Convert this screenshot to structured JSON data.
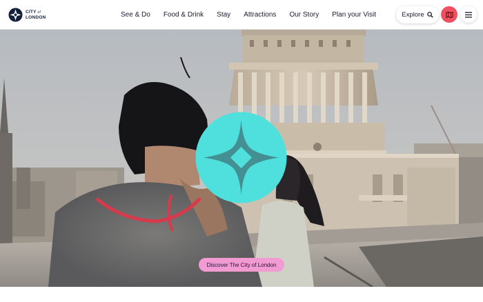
{
  "logo": {
    "line1": "CITY",
    "of": "of",
    "line2": "LONDON"
  },
  "nav": {
    "items": [
      {
        "label": "See & Do"
      },
      {
        "label": "Food & Drink"
      },
      {
        "label": "Stay"
      },
      {
        "label": "Attractions"
      },
      {
        "label": "Our Story"
      },
      {
        "label": "Plan your Visit"
      }
    ]
  },
  "header": {
    "explore_label": "Explore"
  },
  "hero": {
    "cta_label": "Discover The City of London"
  },
  "colors": {
    "accent_teal": "#4fe0dd",
    "map_button": "#f0505f",
    "cta_pink": "#f29bd3",
    "navy": "#14213d"
  }
}
